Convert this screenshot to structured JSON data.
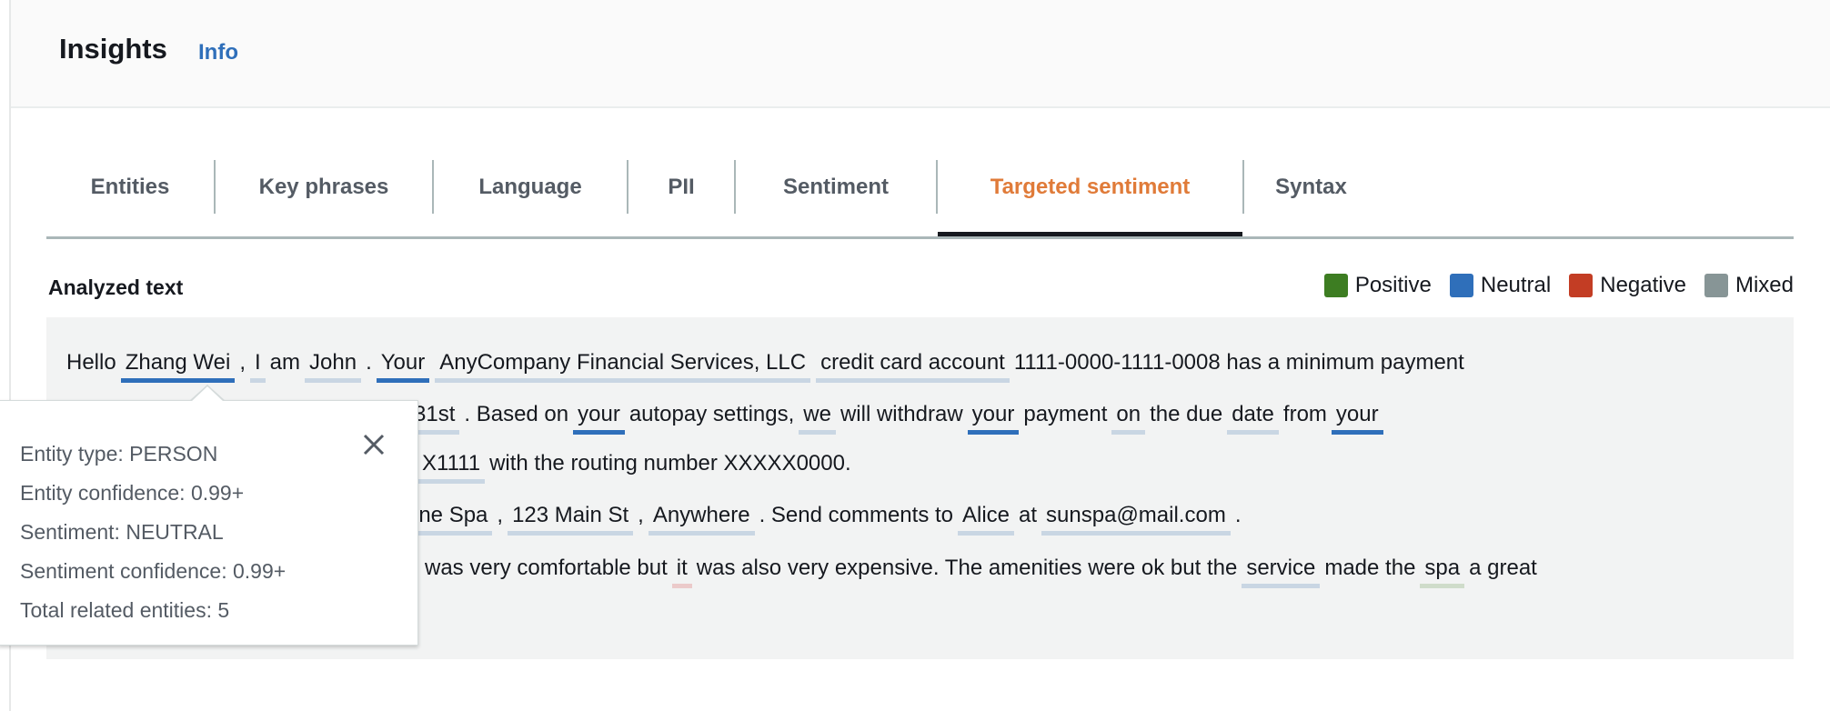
{
  "header": {
    "title": "Insights",
    "info_link": "Info"
  },
  "tabs": [
    {
      "label": "Entities",
      "active": false
    },
    {
      "label": "Key phrases",
      "active": false
    },
    {
      "label": "Language",
      "active": false
    },
    {
      "label": "PII",
      "active": false
    },
    {
      "label": "Sentiment",
      "active": false
    },
    {
      "label": "Targeted sentiment",
      "active": true
    },
    {
      "label": "Syntax",
      "active": false
    }
  ],
  "analyzed": {
    "heading": "Analyzed text"
  },
  "legend": [
    {
      "label": "Positive",
      "color": "#3d7d22"
    },
    {
      "label": "Neutral",
      "color": "#2f6fba"
    },
    {
      "label": "Negative",
      "color": "#c33d24"
    },
    {
      "label": "Mixed",
      "color": "#879596"
    }
  ],
  "text_lines": [
    [
      {
        "t": "Hello"
      },
      {
        "t": "Zhang Wei",
        "s": "neutral",
        "strong": true
      },
      {
        "t": ","
      },
      {
        "t": "I",
        "s": "neutral"
      },
      {
        "t": "am"
      },
      {
        "t": "John",
        "s": "neutral"
      },
      {
        "t": "."
      },
      {
        "t": "Your",
        "s": "neutral",
        "strong": true
      },
      {
        "t": "AnyCompany Financial Services, LLC",
        "s": "neutral"
      },
      {
        "t": "credit card account",
        "s": "neutral"
      },
      {
        "t": "1111-0000-1111-0008 has a minimum payment"
      }
    ],
    [
      {
        "t": "31st",
        "s": "neutral"
      },
      {
        "t": ". Based on"
      },
      {
        "t": "your",
        "s": "neutral",
        "strong": true
      },
      {
        "t": "autopay settings,"
      },
      {
        "t": "we",
        "s": "neutral"
      },
      {
        "t": "will withdraw"
      },
      {
        "t": "your",
        "s": "neutral",
        "strong": true
      },
      {
        "t": "payment"
      },
      {
        "t": "on",
        "s": "neutral"
      },
      {
        "t": "the due"
      },
      {
        "t": "date",
        "s": "neutral"
      },
      {
        "t": "from"
      },
      {
        "t": "your",
        "s": "neutral",
        "strong": true
      }
    ],
    [
      {
        "t": "X1111",
        "s": "neutral"
      },
      {
        "t": "with the routing number XXXXX0000."
      }
    ],
    [
      {
        "t": "ine Spa",
        "s": "neutral"
      },
      {
        "t": ","
      },
      {
        "t": "123 Main St",
        "s": "neutral"
      },
      {
        "t": ","
      },
      {
        "t": "Anywhere",
        "s": "neutral"
      },
      {
        "t": ". Send comments to"
      },
      {
        "t": "Alice",
        "s": "neutral"
      },
      {
        "t": "at"
      },
      {
        "t": "sunspa@mail.com",
        "s": "neutral"
      },
      {
        "t": "."
      }
    ],
    [
      {
        "t": "was very comfortable but"
      },
      {
        "t": "it",
        "s": "negative"
      },
      {
        "t": "was also very expensive. The amenities were ok but the"
      },
      {
        "t": "service",
        "s": "neutral"
      },
      {
        "t": "made the"
      },
      {
        "t": "spa",
        "s": "positive"
      },
      {
        "t": "a great"
      }
    ]
  ],
  "popover": {
    "entity_type": "Entity type: PERSON",
    "entity_confidence": "Entity confidence: 0.99+",
    "sentiment": "Sentiment: NEUTRAL",
    "sentiment_confidence": "Sentiment confidence: 0.99+",
    "total_related": "Total related entities: 5",
    "close_icon": "close-icon"
  }
}
